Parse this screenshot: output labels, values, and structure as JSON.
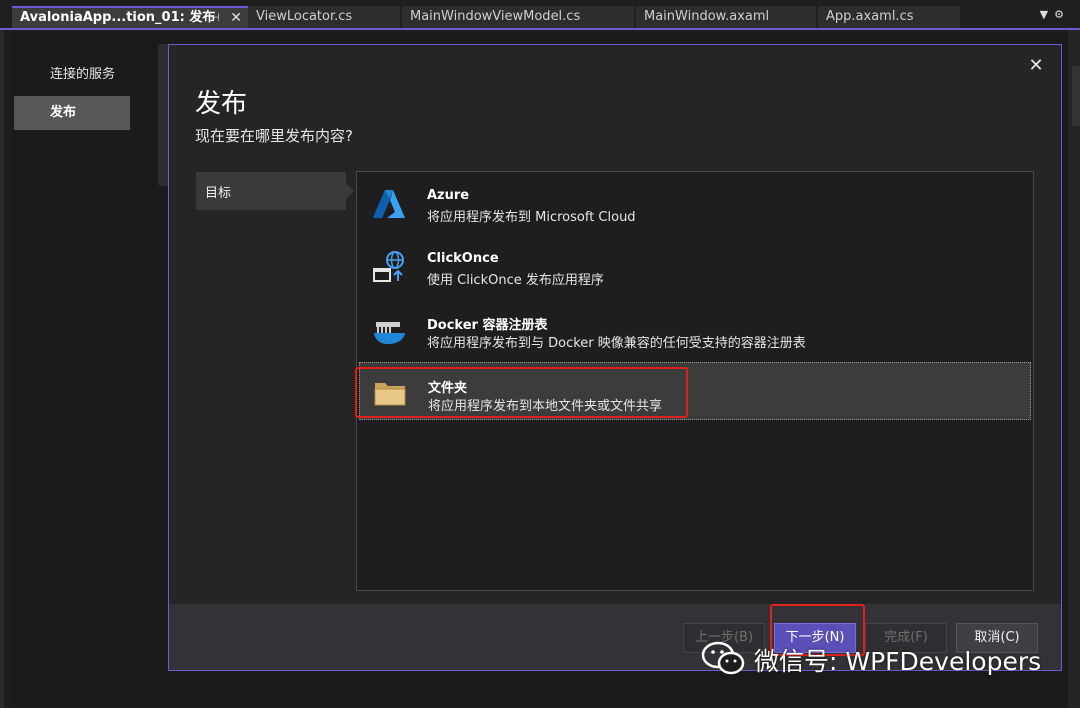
{
  "tabs": [
    {
      "label": "AvaloniaApp...tion_01: 发布",
      "active": true
    },
    {
      "label": "ViewLocator.cs",
      "active": false
    },
    {
      "label": "MainWindowViewModel.cs",
      "active": false
    },
    {
      "label": "MainWindow.axaml",
      "active": false
    },
    {
      "label": "App.axaml.cs",
      "active": false
    }
  ],
  "tab_icons": {
    "pin": "pin-icon",
    "close": "close-icon",
    "dropdown": "dropdown-icon",
    "settings": "gear-icon"
  },
  "leftnav": {
    "items": [
      {
        "label": "连接的服务",
        "selected": false
      },
      {
        "label": "发布",
        "selected": true
      }
    ]
  },
  "dialog": {
    "title": "发布",
    "subtitle": "现在要在哪里发布内容?",
    "close_icon": "close-icon",
    "steps": [
      {
        "label": "目标"
      }
    ],
    "targets": [
      {
        "name": "Azure",
        "description": "将应用程序发布到 Microsoft Cloud",
        "icon": "azure-icon",
        "selected": false
      },
      {
        "name": "ClickOnce",
        "description": "使用 ClickOnce 发布应用程序",
        "icon": "clickonce-icon",
        "selected": false
      },
      {
        "name": "Docker 容器注册表",
        "description": "将应用程序发布到与 Docker 映像兼容的任何受支持的容器注册表",
        "icon": "docker-icon",
        "selected": false
      },
      {
        "name": "文件夹",
        "description": "将应用程序发布到本地文件夹或文件共享",
        "icon": "folder-icon",
        "selected": true
      }
    ],
    "buttons": {
      "back": {
        "label": "上一步(B)",
        "enabled": false
      },
      "next": {
        "label": "下一步(N)",
        "enabled": true
      },
      "finish": {
        "label": "完成(F)",
        "enabled": false
      },
      "cancel": {
        "label": "取消(C)",
        "enabled": true
      }
    }
  },
  "watermark": {
    "text": "微信号: WPFDevelopers",
    "icon": "wechat-icon"
  },
  "colors": {
    "accent": "#6c5ad6",
    "primary_button": "#5b4fb8",
    "annotation": "#e0211b",
    "dialog_bg": "#252526"
  }
}
